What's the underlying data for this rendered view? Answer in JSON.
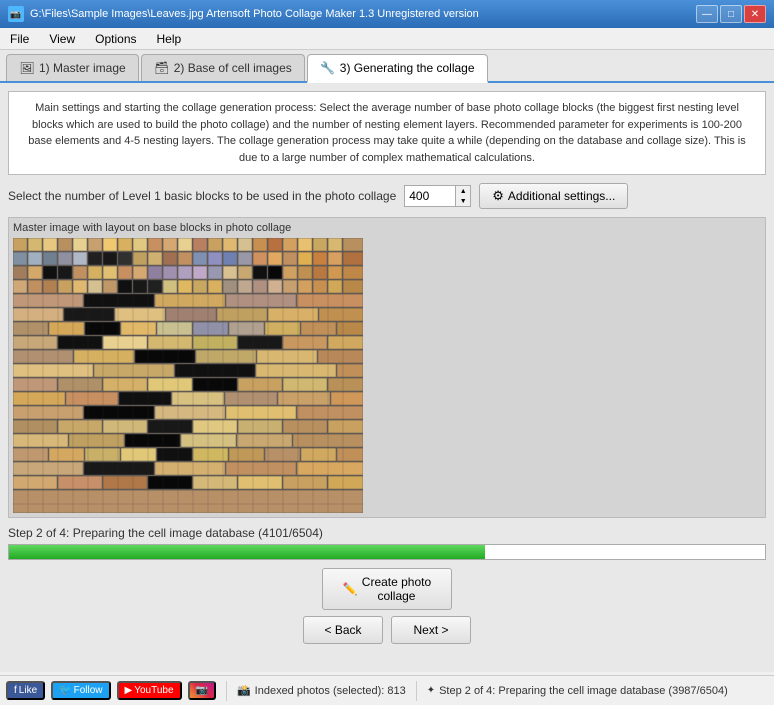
{
  "titleBar": {
    "title": "G:\\Files\\Sample Images\\Leaves.jpg  Artensoft Photo Collage Maker 1.3   Unregistered version",
    "minBtn": "—",
    "maxBtn": "□",
    "closeBtn": "✕"
  },
  "menuBar": {
    "items": [
      "File",
      "View",
      "Options",
      "Help"
    ]
  },
  "tabs": [
    {
      "id": "master",
      "label": "1) Master image",
      "icon": "🖼"
    },
    {
      "id": "base",
      "label": "2) Base of cell images",
      "icon": "🗃"
    },
    {
      "id": "generate",
      "label": "3) Generating the collage",
      "icon": "🔧",
      "active": true
    }
  ],
  "infoBox": {
    "text": "Main settings and starting the collage generation process: Select the average number of base photo collage blocks (the biggest first nesting level blocks which are used to build the photo collage) and the number of nesting element layers. Recommended parameter for experiments is 100-200 base elements and 4-5 nesting layers. The collage generation process may take quite a while (depending on the database and collage size). This is due to a large number of complex mathematical calculations."
  },
  "controls": {
    "label": "Select the number of Level 1 basic blocks to be used in the photo collage",
    "value": "400",
    "additionalBtn": "Additional settings..."
  },
  "imagePanel": {
    "label": "Master image with layout on base blocks in photo collage"
  },
  "progress": {
    "statusText": "Step 2 of 4: Preparing the cell image database (4101/6504)",
    "percent": 63,
    "fillWidth": "63%"
  },
  "buttons": {
    "createLabel": "Create photo\ncollage",
    "backLabel": "< Back",
    "nextLabel": "Next >"
  },
  "statusBar": {
    "fbLabel": "Like",
    "twitterLabel": "Follow",
    "youtubeLabel": "YouTube",
    "indexedLabel": "Indexed photos (selected): 813",
    "stepLabel": "Step 2 of 4: Preparing the cell image database (3987/6504)",
    "spinnerLabel": "✦"
  }
}
